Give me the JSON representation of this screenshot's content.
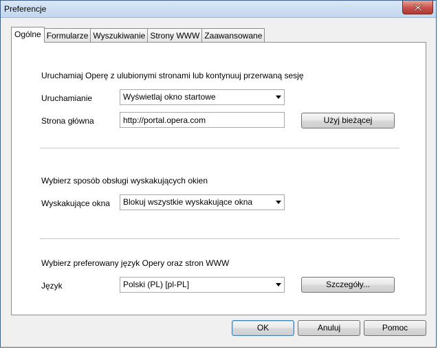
{
  "window": {
    "title": "Preferencje"
  },
  "tabs": [
    {
      "label": "Ogólne"
    },
    {
      "label": "Formularze"
    },
    {
      "label": "Wyszukiwanie"
    },
    {
      "label": "Strony WWW"
    },
    {
      "label": "Zaawansowane"
    }
  ],
  "startup": {
    "heading": "Uruchamiaj Operę z ulubionymi stronami lub kontynuuj przerwaną sesję",
    "startup_label": "Uruchamianie",
    "startup_value": "Wyświetlaj okno startowe",
    "homepage_label": "Strona główna",
    "homepage_value": "http://portal.opera.com",
    "use_current_label": "Użyj bieżącej"
  },
  "popups": {
    "heading": "Wybierz sposób obsługi wyskakujących okien",
    "label": "Wyskakujące okna",
    "value": "Blokuj wszystkie wyskakujące okna"
  },
  "language": {
    "heading": "Wybierz preferowany język Opery oraz stron WWW",
    "label": "Język",
    "value": "Polski (PL) [pl-PL]",
    "details_label": "Szczegóły..."
  },
  "footer": {
    "ok_label": "OK",
    "cancel_label": "Anuluj",
    "help_label": "Pomoc"
  }
}
